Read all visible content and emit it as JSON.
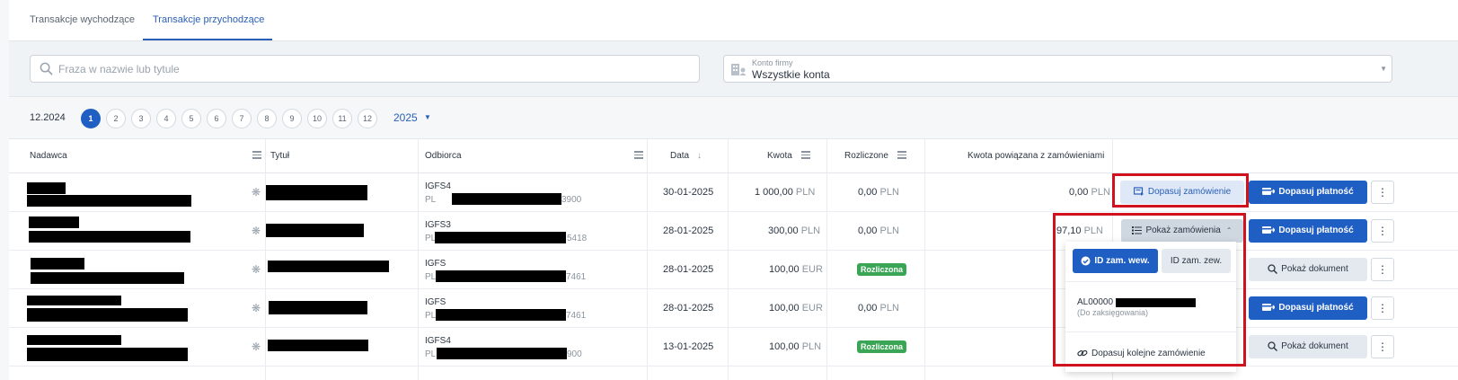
{
  "tabs": [
    {
      "label": "Transakcje wychodzące",
      "active": false
    },
    {
      "label": "Transakcje przychodzące",
      "active": true
    }
  ],
  "search": {
    "placeholder": "Fraza w nazwie lub tytule",
    "value": ""
  },
  "account_filter": {
    "label": "Konto firmy",
    "value": "Wszystkie konta"
  },
  "months": {
    "previous": "12.2024",
    "items": [
      "1",
      "2",
      "3",
      "4",
      "5",
      "6",
      "7",
      "8",
      "9",
      "10",
      "11",
      "12"
    ],
    "active": "1",
    "year": "2025"
  },
  "columns": {
    "sender": "Nadawca",
    "title": "Tytuł",
    "receiver": "Odbiorca",
    "date": "Data",
    "amount": "Kwota",
    "settled": "Rozliczone",
    "linked": "Kwota powiązana z zamówieniami"
  },
  "rows": [
    {
      "receiver_name": "IGFS4",
      "receiver_pl": "PL",
      "receiver_tail": "3900",
      "date": "30-01-2025",
      "amount": "1 000,00",
      "amount_currency": "PLN",
      "settled": "0,00",
      "settled_currency": "PLN",
      "linked": "0,00",
      "linked_currency": "PLN"
    },
    {
      "receiver_name": "IGFS3",
      "receiver_pl": "PL",
      "receiver_tail": "5418",
      "date": "28-01-2025",
      "amount": "300,00",
      "amount_currency": "PLN",
      "settled": "0,00",
      "settled_currency": "PLN",
      "linked": "97,10",
      "linked_currency": "PLN"
    },
    {
      "receiver_name": "IGFS",
      "receiver_pl": "PL",
      "receiver_tail": "7461",
      "date": "28-01-2025",
      "amount": "100,00",
      "amount_currency": "EUR",
      "settled_badge": "Rozliczona",
      "linked_partial": "0"
    },
    {
      "receiver_name": "IGFS",
      "receiver_pl": "PL",
      "receiver_tail": "7461",
      "date": "28-01-2025",
      "amount": "100,00",
      "amount_currency": "EUR",
      "settled": "0,00",
      "settled_currency": "PLN",
      "linked_partial": "0"
    },
    {
      "receiver_name": "IGFS4",
      "receiver_pl": "PL",
      "receiver_tail": "900",
      "date": "13-01-2025",
      "amount": "100,00",
      "amount_currency": "PLN",
      "settled_badge": "Rozliczona",
      "linked_partial": "0"
    }
  ],
  "actions": {
    "match_order": "Dopasuj zamówienie",
    "match_payment": "Dopasuj płatność",
    "show_orders": "Pokaż zamówienia",
    "show_document": "Pokaż dokument",
    "more": "⋮"
  },
  "dropdown": {
    "internal_id": "ID zam. wew.",
    "external_id": "ID zam. zew.",
    "order_prefix": "AL00000",
    "order_status": "(Do zaksięgowania)",
    "match_next": "Dopasuj kolejne zamówienie"
  },
  "colors": {
    "accent": "#1f5fc4",
    "highlight": "#d0121f",
    "success": "#3aa655"
  }
}
